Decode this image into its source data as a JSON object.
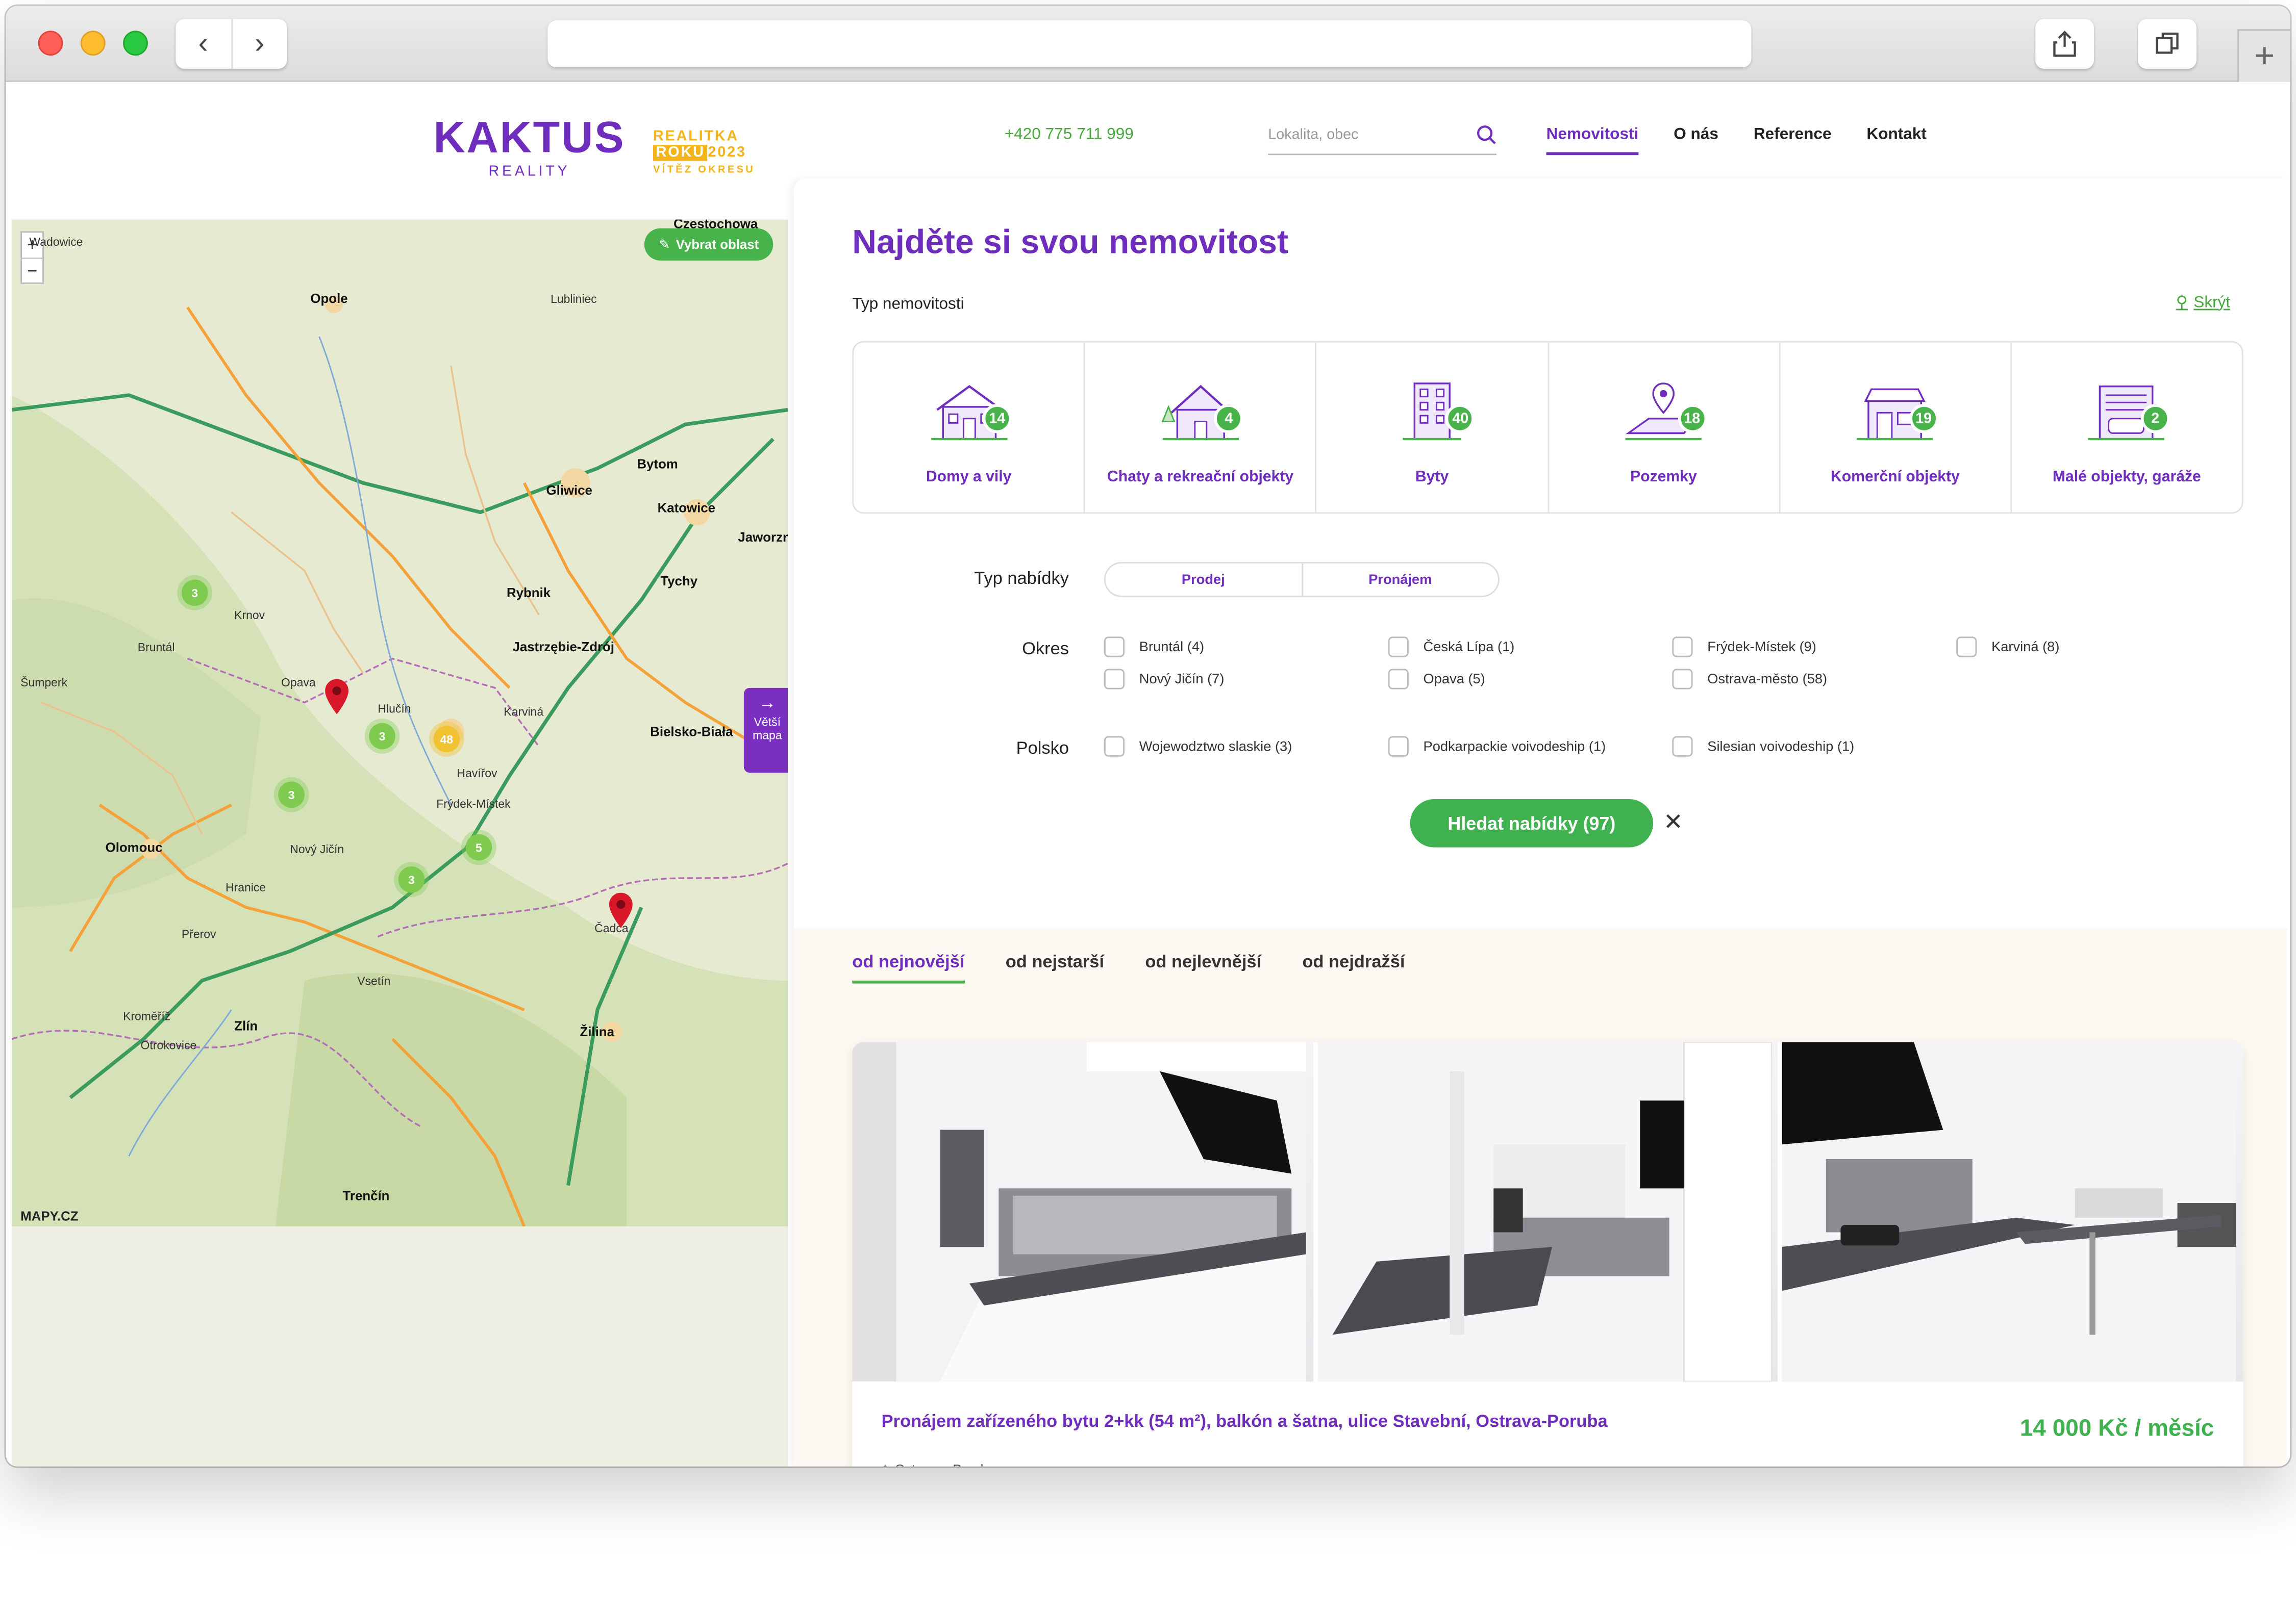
{
  "header": {
    "logo_text": "KAKTUS",
    "logo_sub": "REALITY",
    "award_line1": "REALITKA",
    "award_line2a": "ROKU",
    "award_line2b": "2023",
    "award_line3": "VÍTĚZ OKRESU",
    "phone": "+420 775 711 999",
    "search_placeholder": "Lokalita, obec",
    "nav": [
      "Nemovitosti",
      "O nás",
      "Reference",
      "Kontakt"
    ]
  },
  "map": {
    "select_area": "Vybrat oblast",
    "bigger_map_line1": "Větší",
    "bigger_map_line2": "mapa",
    "attribution": "MAPY.CZ",
    "zoom_in": "+",
    "zoom_out": "−",
    "clusters": [
      "3",
      "3",
      "48",
      "3",
      "5",
      "3"
    ],
    "cities": [
      "Opole",
      "Gliwice",
      "Bytom",
      "Katowice",
      "Rybnik",
      "Tychy",
      "Jastrzębie-Zdrój",
      "Bielsko-Biała",
      "Opava",
      "Olomouc",
      "Zlín",
      "Žilina",
      "Trenčín",
      "Přerov",
      "Nový Jičín",
      "Frýdek-Místek",
      "Havířov",
      "Karviná",
      "Krnov",
      "Bruntál",
      "Šumperk",
      "Hlučín",
      "Vsetín",
      "Čadca",
      "Hranice",
      "Kroměříž",
      "Otrokovice",
      "Czestochowa",
      "Lubliniec",
      "Jaworzno",
      "Wadowice"
    ]
  },
  "main": {
    "title": "Najděte si svou nemovitost",
    "type_label": "Typ nemovitosti",
    "hide": "Skrýt",
    "types": [
      {
        "label": "Domy a vily",
        "count": "14"
      },
      {
        "label": "Chaty a rekreační objekty",
        "count": "4"
      },
      {
        "label": "Byty",
        "count": "40"
      },
      {
        "label": "Pozemky",
        "count": "18"
      },
      {
        "label": "Komerční objekty",
        "count": "19"
      },
      {
        "label": "Malé objekty, garáže",
        "count": "2"
      }
    ],
    "offer_label": "Typ nabídky",
    "offers": [
      "Prodej",
      "Pronájem"
    ],
    "district_label": "Okres",
    "districts": [
      "Bruntál (4)",
      "Česká Lípa (1)",
      "Frýdek-Místek (9)",
      "Karviná (8)",
      "Nový Jičín (7)",
      "Opava (5)",
      "Ostrava-město (58)"
    ],
    "poland_label": "Polsko",
    "poland": [
      "Wojewodztwo slaskie (3)",
      "Podkarpackie voivodeship (1)",
      "Silesian voivodeship (1)"
    ],
    "search_button": "Hledat nabídky (97)",
    "close": "✕",
    "sort": [
      "od nejnovější",
      "od nejstarší",
      "od nejlevnější",
      "od nejdražší"
    ],
    "listing": {
      "title": "Pronájem zařízeného bytu 2+kk (54 m²), balkón a šatna, ulice Stavební, Ostrava-Poruba",
      "price": "14 000 Kč / měsíc",
      "location": "Ostrava - Poruba"
    }
  },
  "colors": {
    "brand": "#6f2dbd",
    "accent": "#47b34a",
    "award": "#f3b51a"
  }
}
